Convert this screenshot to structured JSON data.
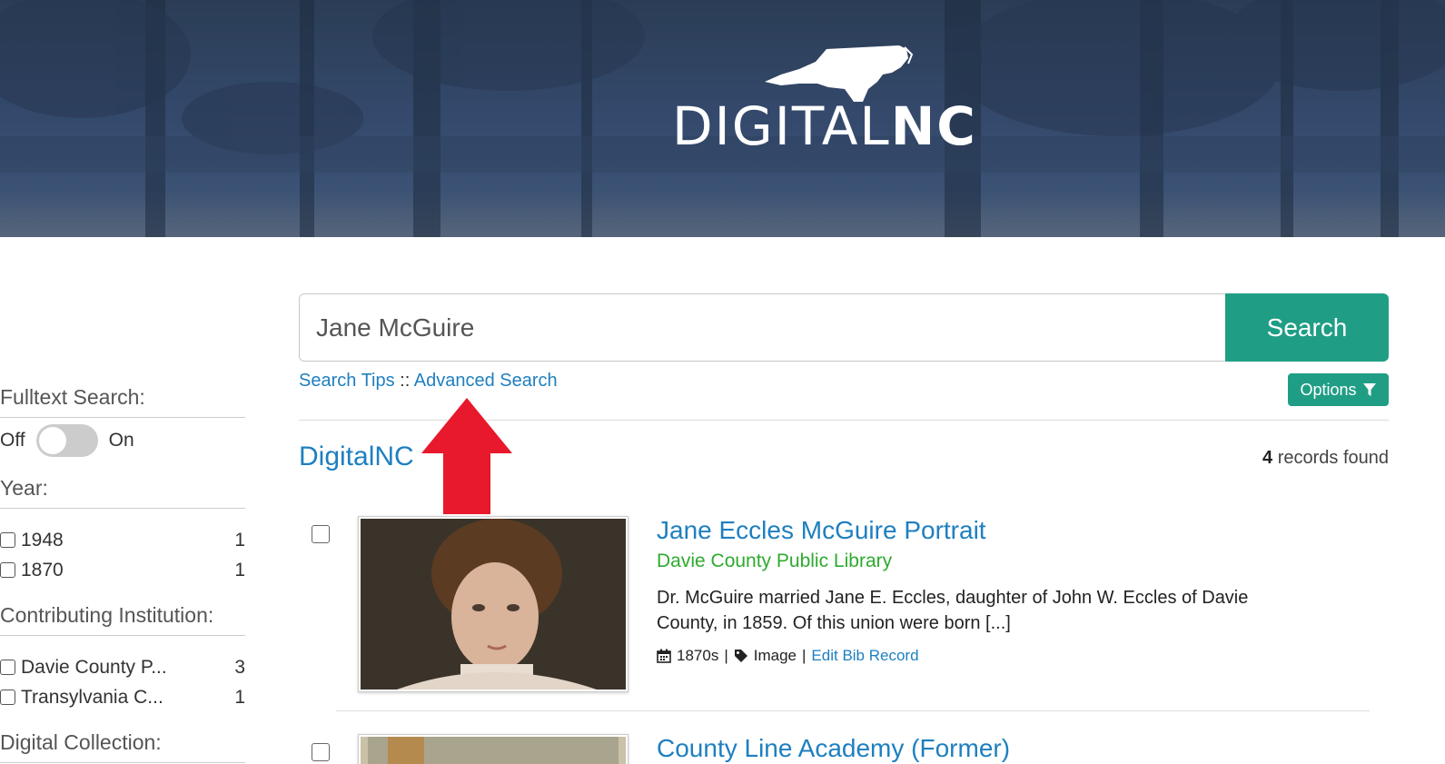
{
  "header": {
    "logo_text_light": "DIGITAL",
    "logo_text_bold": "NC",
    "background_color": "#33486a"
  },
  "search": {
    "value": "Jane McGuire",
    "button_label": "Search",
    "search_tips_label": "Search Tips",
    "separator": " :: ",
    "advanced_label": "Advanced Search",
    "options_label": "Options",
    "accent_color": "#1f9e85"
  },
  "results_header": {
    "source": "DigitalNC",
    "count": "4",
    "count_suffix": " records found"
  },
  "sidebar": {
    "fulltext_title": "Fulltext Search:",
    "toggle_off": "Off",
    "toggle_on": "On",
    "year_title": "Year:",
    "years": [
      {
        "label": "1948",
        "count": "1"
      },
      {
        "label": "1870",
        "count": "1"
      }
    ],
    "institution_title": "Contributing Institution:",
    "institutions": [
      {
        "label": "Davie County P...",
        "count": "3"
      },
      {
        "label": "Transylvania C...",
        "count": "1"
      }
    ],
    "collection_title": "Digital Collection:"
  },
  "results": [
    {
      "title": "Jane Eccles McGuire Portrait",
      "institution": "Davie County Public Library",
      "description": "Dr. McGuire married Jane E. Eccles, daughter of John W. Eccles of Davie County, in 1859. Of this union were born [...]",
      "date": "1870s",
      "pipe": "|",
      "type": "Image",
      "edit_label": "Edit Bib Record"
    },
    {
      "title": "County Line Academy (Former)"
    }
  ],
  "annotation": {
    "arrow_color": "#e8192c"
  }
}
